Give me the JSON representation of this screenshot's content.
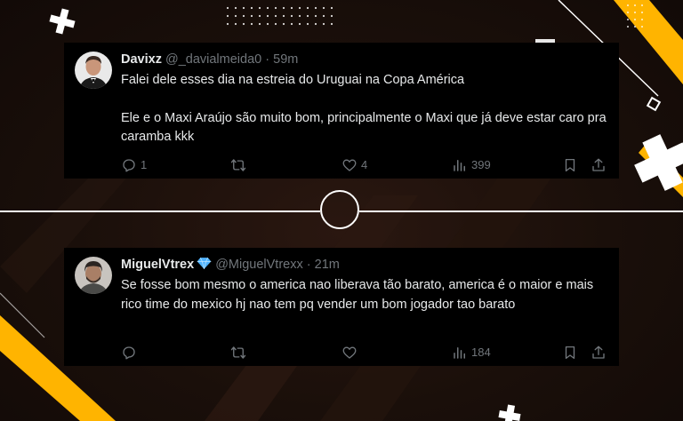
{
  "tweets": [
    {
      "display_name": "Davixz",
      "handle": "@_davialmeida0",
      "separator": "·",
      "time": "59m",
      "paragraphs": [
        "Falei dele esses dia na estreia do Uruguai na Copa América",
        "Ele e o Maxi Araújo são muito bom, principalmente o Maxi que já deve estar caro pra caramba kkk"
      ],
      "replies": "1",
      "reposts": "",
      "likes": "4",
      "views": "399",
      "avatar_icon": "person-avatar-icon"
    },
    {
      "display_name": "MiguelVtrex",
      "verified_icon": "diamond-verified-icon",
      "handle": "@MiguelVtrexx",
      "separator": "·",
      "time": "21m",
      "paragraphs": [
        "Se fosse bom mesmo o america nao liberava tão barato, america é o maior e mais rico time do mexico hj nao tem pq vender um bom jogador tao barato"
      ],
      "replies": "",
      "reposts": "",
      "likes": "",
      "views": "184",
      "avatar_icon": "person-avatar-icon"
    }
  ],
  "colors": {
    "background": "#140c08",
    "tweet_bg": "#000000",
    "text": "#e7e9ea",
    "muted": "#71767b",
    "accent_yellow": "#ffb400",
    "verified_blue": "#4fb3ff"
  }
}
